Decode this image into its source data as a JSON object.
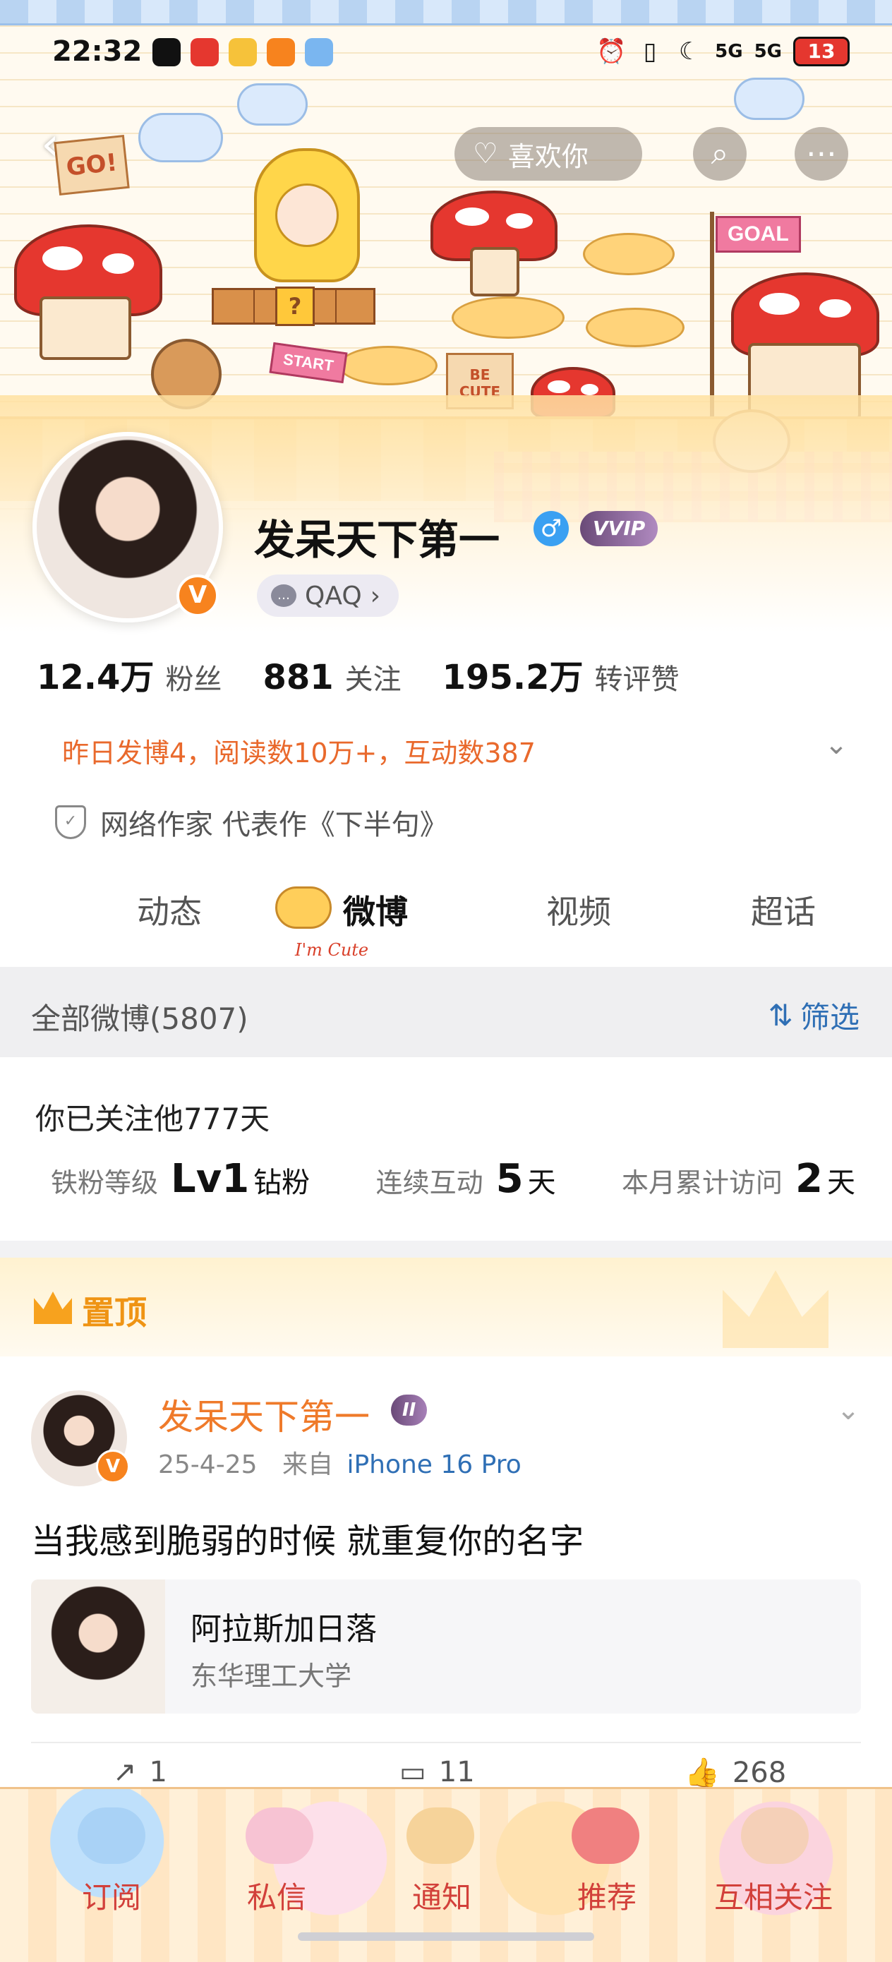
{
  "status_bar": {
    "time": "22:32",
    "signal_1": "5G",
    "signal_2": "5G",
    "battery": "13"
  },
  "header": {
    "like_label": "喜欢你",
    "banner_labels": {
      "go": "GO!",
      "start": "START",
      "be_cute": "BE CUTE",
      "goal": "GOAL"
    }
  },
  "profile": {
    "nickname": "发呆天下第一",
    "gender_symbol": "♂",
    "vip_badge": "VVIP",
    "verified_mark": "V",
    "qaq_label": "QAQ",
    "stats": [
      {
        "value": "12.4万",
        "label": "粉丝"
      },
      {
        "value": "881",
        "label": "关注"
      },
      {
        "value": "195.2万",
        "label": "转评赞"
      }
    ],
    "yesterday_summary": "昨日发博4，阅读数10万+，互动数387",
    "certification": "网络作家 代表作《下半句》"
  },
  "tabs": [
    {
      "label": "动态"
    },
    {
      "label": "微博"
    },
    {
      "label": "视频"
    },
    {
      "label": "超话"
    }
  ],
  "tab_sub_caption": "I'm Cute",
  "filter": {
    "all_posts": "全部微博(5807)",
    "filter_label": "筛选"
  },
  "follow_info": {
    "days_text": "你已关注他777天",
    "fan_level_label": "铁粉等级",
    "fan_level_value": "Lv1",
    "fan_level_unit": "钻粉",
    "streak_label": "连续互动",
    "streak_value": "5",
    "streak_unit": "天",
    "visits_label": "本月累计访问",
    "visits_value": "2",
    "visits_unit": "天"
  },
  "pinned": {
    "label": "置顶"
  },
  "post": {
    "author": "发呆天下第一",
    "badge": "II",
    "date": "25-4-25",
    "source_prefix": "来自",
    "source": "iPhone 16 Pro",
    "text": "当我感到脆弱的时候 就重复你的名字",
    "card_title": "阿拉斯加日落",
    "card_subtitle": "东华理工大学",
    "reposts": "1",
    "comments": "11",
    "likes": "268"
  },
  "bottom_nav": [
    {
      "label": "订阅"
    },
    {
      "label": "私信"
    },
    {
      "label": "通知"
    },
    {
      "label": "推荐"
    },
    {
      "label": "互相关注"
    }
  ],
  "colors": {
    "accent_orange": "#ef7a2a",
    "link_blue": "#2f6fb5",
    "mushroom_red": "#e5372f",
    "nav_red": "#d2403a"
  }
}
